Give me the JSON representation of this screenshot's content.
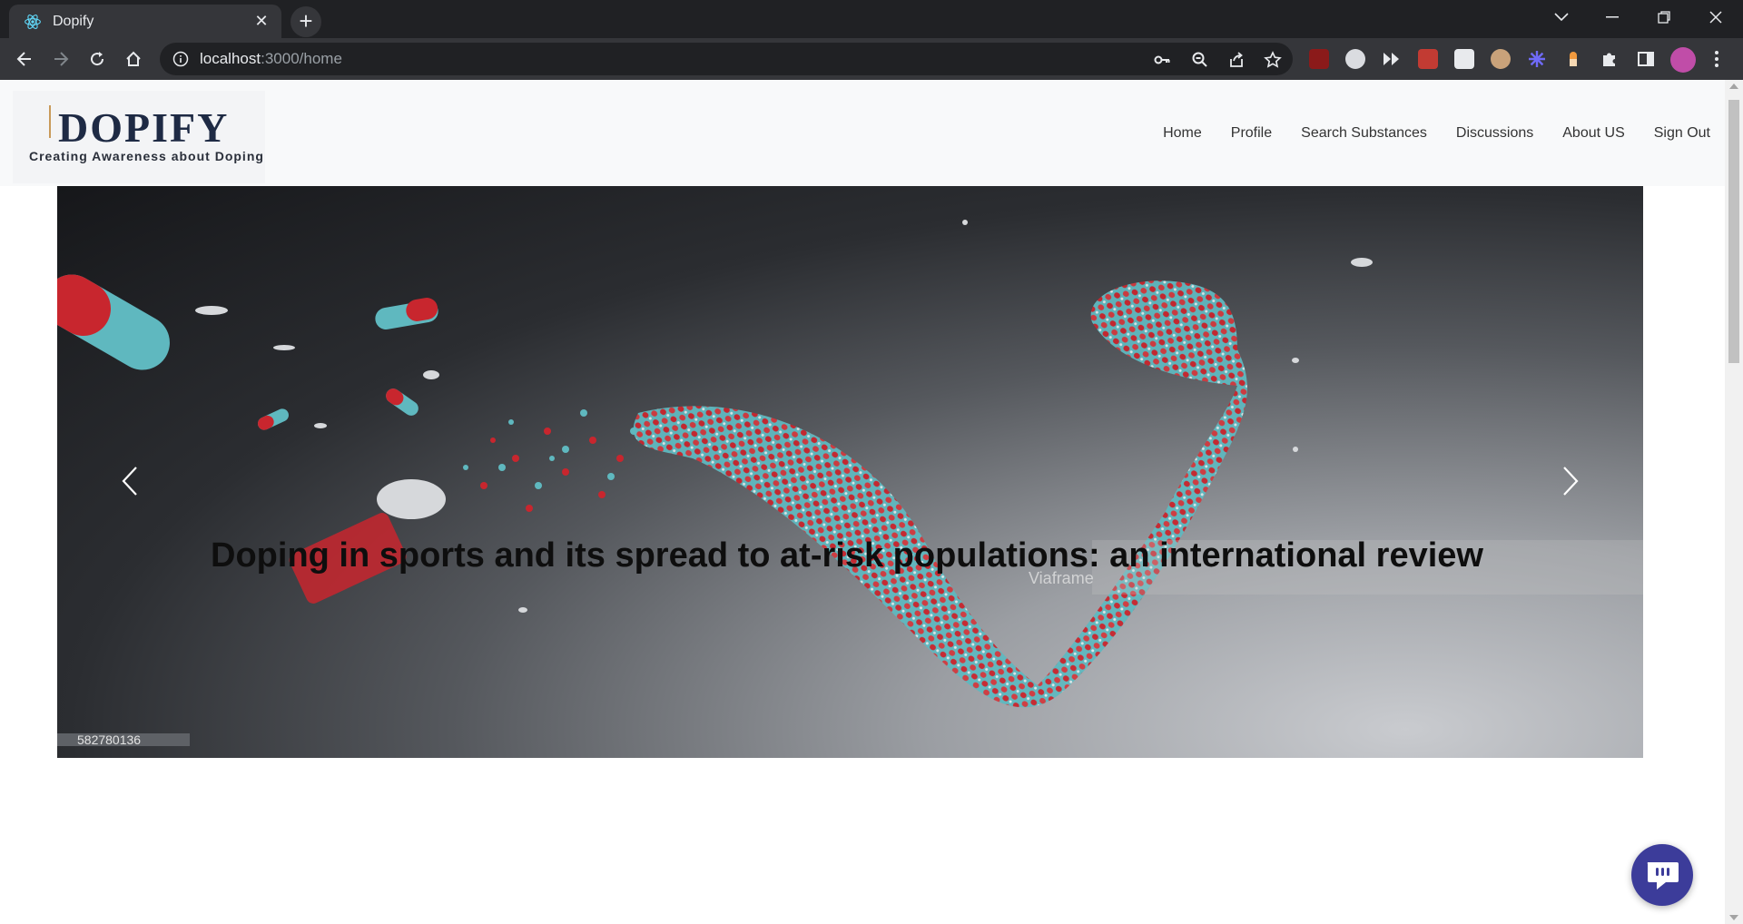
{
  "browser": {
    "tab_title": "Dopify",
    "tab_close": "✕",
    "new_tab": "+",
    "url_host": "localhost",
    "url_path": ":3000/home"
  },
  "site": {
    "logo_name": "DOPIFY",
    "logo_tagline": "Creating Awareness about Doping",
    "nav": [
      "Home",
      "Profile",
      "Search Substances",
      "Discussions",
      "About US",
      "Sign Out"
    ]
  },
  "carousel": {
    "caption": "Doping in sports and its spread to at-risk populations: an international review",
    "image_watermark": "Viaframe",
    "image_id": "582780136"
  },
  "colors": {
    "browser_dark": "#202124",
    "browser_toolbar": "#35363a",
    "header_bg": "#f8f9fa",
    "logo_navy": "#1e2a44",
    "chat_button": "#3c3c9a",
    "pill_red": "#c8262e",
    "pill_teal": "#5fb8bf"
  },
  "icons": {
    "tab_favicon": "react-atom-icon",
    "back": "arrow-left-icon",
    "forward": "arrow-right-icon",
    "reload": "reload-icon",
    "home": "home-icon",
    "site_info": "info-icon",
    "password": "key-icon",
    "zoom": "zoom-icon",
    "share": "share-icon",
    "bookmark": "star-icon",
    "carousel_prev": "chevron-left-icon",
    "carousel_next": "chevron-right-icon",
    "chat": "chat-bubble-icon"
  }
}
